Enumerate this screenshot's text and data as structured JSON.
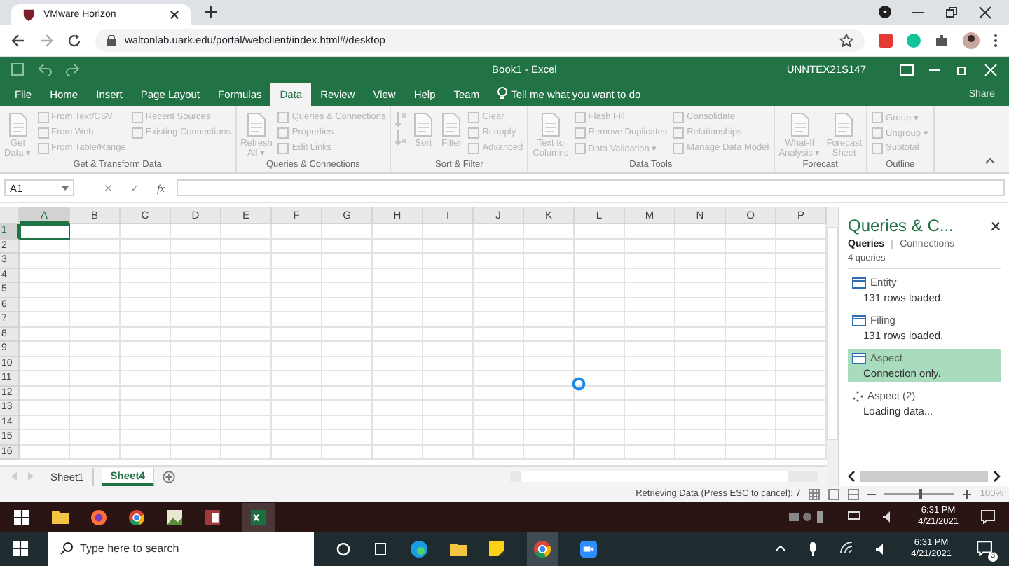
{
  "browser": {
    "tab_title": "VMware Horizon",
    "url": "waltonlab.uark.edu/portal/webclient/index.html#/desktop"
  },
  "excel": {
    "title": "Book1  -  Excel",
    "user": "UNNTEX21S147",
    "share": "Share"
  },
  "ribbon_tabs": [
    {
      "label": "File",
      "selected": false
    },
    {
      "label": "Home",
      "selected": false
    },
    {
      "label": "Insert",
      "selected": false
    },
    {
      "label": "Page Layout",
      "selected": false
    },
    {
      "label": "Formulas",
      "selected": false
    },
    {
      "label": "Data",
      "selected": true
    },
    {
      "label": "Review",
      "selected": false
    },
    {
      "label": "View",
      "selected": false
    },
    {
      "label": "Help",
      "selected": false
    },
    {
      "label": "Team",
      "selected": false
    }
  ],
  "tell_me": "Tell me what you want to do",
  "ribbon_groups": [
    {
      "label": "Get & Transform Data",
      "items": [
        {
          "kind": "large",
          "lines": [
            "Get",
            "Data ▾"
          ]
        },
        {
          "kind": "column",
          "texts": [
            "From Text/CSV",
            "From Web",
            "From Table/Range"
          ]
        },
        {
          "kind": "column",
          "texts": [
            "Recent Sources",
            "Existing Connections"
          ]
        }
      ]
    },
    {
      "label": "Queries & Connections",
      "items": [
        {
          "kind": "large",
          "lines": [
            "Refresh",
            "All ▾"
          ]
        },
        {
          "kind": "column",
          "texts": [
            "Queries & Connections",
            "Properties",
            "Edit Links"
          ]
        }
      ]
    },
    {
      "label": "Sort & Filter",
      "items": [
        {
          "kind": "sorticons"
        },
        {
          "kind": "large",
          "lines": [
            "Sort"
          ]
        },
        {
          "kind": "large",
          "lines": [
            "Filter"
          ]
        },
        {
          "kind": "column",
          "texts": [
            "Clear",
            "Reapply",
            "Advanced"
          ]
        }
      ]
    },
    {
      "label": "Data Tools",
      "items": [
        {
          "kind": "large",
          "lines": [
            "Text to",
            "Columns"
          ]
        },
        {
          "kind": "column",
          "texts": [
            "Flash Fill",
            "Remove Duplicates",
            "Data Validation ▾"
          ]
        },
        {
          "kind": "column",
          "texts": [
            "Consolidate",
            "Relationships",
            "Manage Data Model"
          ]
        }
      ]
    },
    {
      "label": "Forecast",
      "items": [
        {
          "kind": "large",
          "lines": [
            "What-If",
            "Analysis ▾"
          ]
        },
        {
          "kind": "large",
          "lines": [
            "Forecast",
            "Sheet"
          ]
        }
      ]
    },
    {
      "label": "Outline",
      "items": [
        {
          "kind": "column",
          "texts": [
            "Group ▾",
            "Ungroup ▾",
            "Subtotal"
          ]
        }
      ]
    }
  ],
  "formula_bar": {
    "name_box": "A1",
    "buttons": [
      "✕",
      "✓",
      "fx"
    ]
  },
  "columns": [
    {
      "label": "A",
      "selected": true
    },
    {
      "label": "B",
      "selected": false
    },
    {
      "label": "C",
      "selected": false
    },
    {
      "label": "D",
      "selected": false
    },
    {
      "label": "E",
      "selected": false
    },
    {
      "label": "F",
      "selected": false
    },
    {
      "label": "G",
      "selected": false
    },
    {
      "label": "H",
      "selected": false
    },
    {
      "label": "I",
      "selected": false
    },
    {
      "label": "J",
      "selected": false
    },
    {
      "label": "K",
      "selected": false
    },
    {
      "label": "L",
      "selected": false
    },
    {
      "label": "M",
      "selected": false
    },
    {
      "label": "N",
      "selected": false
    },
    {
      "label": "O",
      "selected": false
    },
    {
      "label": "P",
      "selected": false
    }
  ],
  "rows": [
    {
      "label": "1",
      "selected": true
    },
    {
      "label": "2",
      "selected": false
    },
    {
      "label": "3",
      "selected": false
    },
    {
      "label": "4",
      "selected": false
    },
    {
      "label": "5",
      "selected": false
    },
    {
      "label": "6",
      "selected": false
    },
    {
      "label": "7",
      "selected": false
    },
    {
      "label": "8",
      "selected": false
    },
    {
      "label": "9",
      "selected": false
    },
    {
      "label": "10",
      "selected": false
    },
    {
      "label": "11",
      "selected": false
    },
    {
      "label": "12",
      "selected": false
    },
    {
      "label": "13",
      "selected": false
    },
    {
      "label": "14",
      "selected": false
    },
    {
      "label": "15",
      "selected": false
    },
    {
      "label": "16",
      "selected": false
    }
  ],
  "sheets": [
    {
      "label": "Sheet1",
      "selected": false
    },
    {
      "label": "Sheet4",
      "selected": true
    }
  ],
  "pane": {
    "title": "Queries & C...",
    "tabs": [
      {
        "label": "Queries",
        "selected": true
      },
      {
        "label": "Connections",
        "selected": false
      }
    ],
    "count": "4 queries",
    "queries": [
      {
        "name": "Entity",
        "status": "131 rows loaded.",
        "kind": "table",
        "selected": false
      },
      {
        "name": "Filing",
        "status": "131 rows loaded.",
        "kind": "table",
        "selected": false
      },
      {
        "name": "Aspect",
        "status": "Connection only.",
        "kind": "table",
        "selected": true
      },
      {
        "name": "Aspect (2)",
        "status": "Loading data...",
        "kind": "loading",
        "selected": false
      }
    ]
  },
  "status_bar": {
    "message": "Retrieving Data (Press ESC to cancel): 7",
    "zoom": {
      "level": 0.5,
      "reading": "100%"
    }
  },
  "vm_taskbar": {
    "time": "6:31 PM",
    "date": "4/21/2021"
  },
  "taskbar": {
    "search": {
      "placeholder": "Type here to search"
    },
    "time": "6:31 PM",
    "date": "4/21/2021",
    "notifications": "3"
  }
}
